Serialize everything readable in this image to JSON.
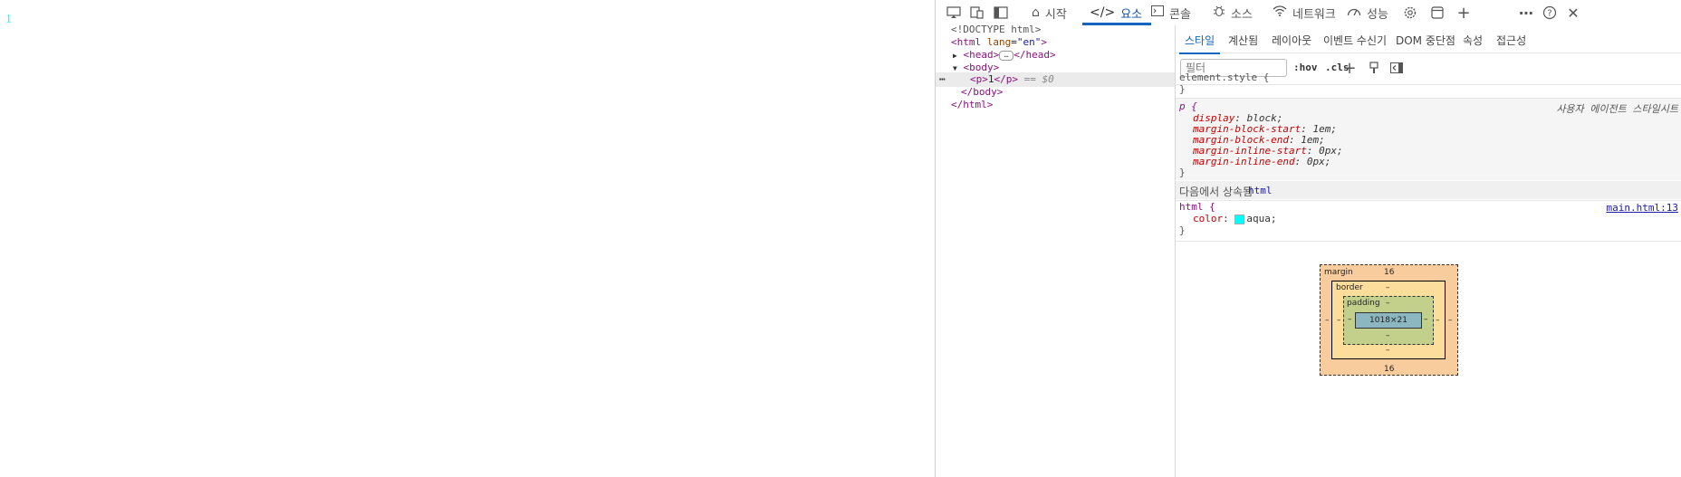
{
  "page": {
    "text": "1",
    "text_color": "#00ffff"
  },
  "devtools": {
    "top_icons": [
      "cast-icon",
      "device-emulation-icon",
      "dock-icon"
    ],
    "tabs": [
      {
        "label": "시작",
        "icon": "home-icon"
      },
      {
        "label": "요소",
        "icon": "code-icon",
        "active": true
      },
      {
        "label": "콘솔",
        "icon": "console-icon"
      },
      {
        "label": "소스",
        "icon": "bug-icon"
      },
      {
        "label": "네트워크",
        "icon": "wifi-icon"
      },
      {
        "label": "성능",
        "icon": "gauge-icon"
      }
    ],
    "right_icons": [
      "settings-gear-icon",
      "window-icon",
      "add-tab-icon",
      "more-icon",
      "help-icon",
      "close-icon"
    ],
    "tree": {
      "doctype": "<!DOCTYPE html>",
      "html_open_tag": "html",
      "html_attr_name": "lang",
      "html_attr_value": "\"en\"",
      "head_tag": "head",
      "body_tag": "body",
      "p_tag": "p",
      "p_text": "1",
      "selected_suffix": "== $0",
      "body_close": "</body>",
      "html_close": "</html>"
    },
    "styles": {
      "subtabs": [
        "스타일",
        "계산됨",
        "레이아웃",
        "이벤트 수신기",
        "DOM 중단점",
        "속성",
        "접근성"
      ],
      "filter_placeholder": "필터",
      "hov_label": ":hov",
      "cls_label": ".cls",
      "element_style": {
        "selector": "element.style {",
        "close": "}"
      },
      "ua_rule": {
        "selector": "p {",
        "source": "사용자 에이전트 스타일시트",
        "props": [
          {
            "name": "display",
            "value": "block;"
          },
          {
            "name": "margin-block-start",
            "value": "1em;"
          },
          {
            "name": "margin-block-end",
            "value": "1em;"
          },
          {
            "name": "margin-inline-start",
            "value": "0px;"
          },
          {
            "name": "margin-inline-end",
            "value": "0px;"
          }
        ],
        "close": "}"
      },
      "inherited_header": "다음에서 상속됨",
      "inherited_from": "html",
      "html_rule": {
        "selector": "html {",
        "source": "main.html:13",
        "prop_name": "color",
        "prop_value": "aqua;",
        "swatch_color": "#00ffff",
        "close": "}"
      },
      "box_model": {
        "margin_label": "margin",
        "margin_top": "16",
        "margin_bottom": "16",
        "margin_left": "–",
        "margin_right": "–",
        "border_label": "border",
        "border_value": "–",
        "padding_label": "padding",
        "padding_value": "–",
        "content_size": "1018×21"
      }
    }
  }
}
